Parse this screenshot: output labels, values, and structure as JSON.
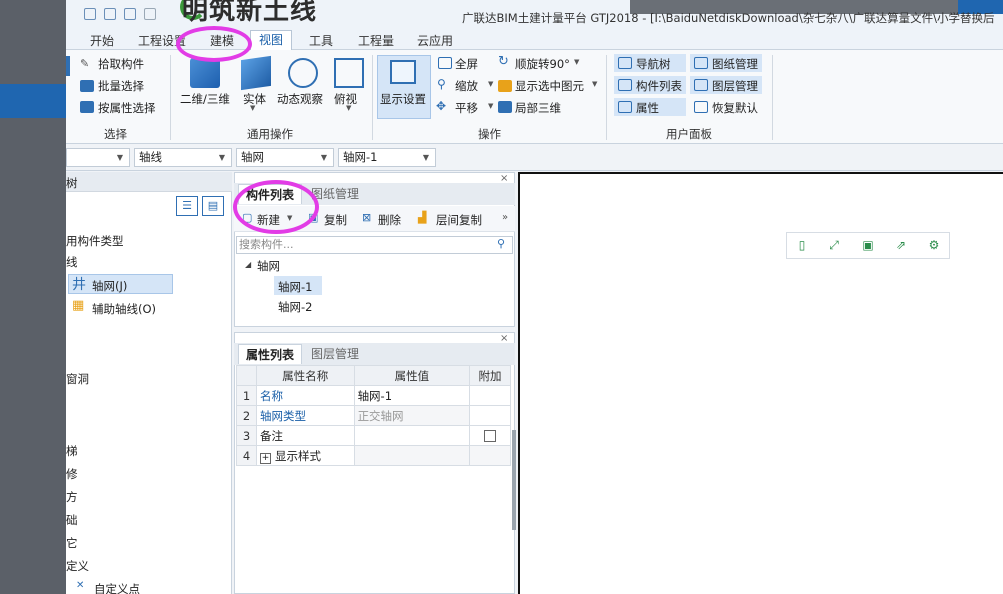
{
  "window": {
    "title": "广联达BIM土建计量平台 GTJ2018 - [I:\\BaiduNetdiskDownload\\杂七杂八\\广联达算量文件\\小学替换后",
    "watermark": "明筑新土线"
  },
  "menu": {
    "tabs": [
      {
        "label": "开始",
        "active": false
      },
      {
        "label": "工程设置",
        "active": false
      },
      {
        "label": "建模",
        "active": false
      },
      {
        "label": "视图",
        "active": true
      },
      {
        "label": "工具",
        "active": false
      },
      {
        "label": "工程量",
        "active": false
      },
      {
        "label": "云应用",
        "active": false
      }
    ]
  },
  "ribbon": {
    "select_group": {
      "label": "选择",
      "items": [
        "拾取构件",
        "批量选择",
        "按属性选择"
      ]
    },
    "general_group": {
      "label": "通用操作",
      "items": [
        "二维/三维",
        "实体",
        "动态观察",
        "俯视"
      ]
    },
    "operate_group": {
      "label": "操作",
      "display_settings": "显示设置",
      "items": [
        "全屏",
        "缩放",
        "平移",
        "顺旋转90°",
        "显示选中图元",
        "局部三维"
      ]
    },
    "user_panel_group": {
      "label": "用户面板",
      "items": [
        "导航树",
        "图纸管理",
        "构件列表",
        "图层管理",
        "属性",
        "恢复默认"
      ]
    }
  },
  "selectors": {
    "floor": "",
    "category": "轴线",
    "type": "轴网",
    "instance": "轴网-1"
  },
  "navigator": {
    "title_partial": "树",
    "items": [
      {
        "label": "用构件类型",
        "selected": false
      },
      {
        "label": "线",
        "selected": false
      },
      {
        "label": "轴网(J)",
        "selected": true
      },
      {
        "label": "辅助轴线(O)",
        "selected": false
      },
      {
        "label": "窗洞",
        "selected": false
      },
      {
        "label": "梯",
        "selected": false
      },
      {
        "label": "修",
        "selected": false
      },
      {
        "label": "方",
        "selected": false
      },
      {
        "label": "础",
        "selected": false
      },
      {
        "label": "它",
        "selected": false
      },
      {
        "label": "定义",
        "selected": false
      },
      {
        "label": "自定义点",
        "selected": false
      }
    ]
  },
  "component_panel": {
    "tabs": [
      {
        "label": "构件列表",
        "active": true
      },
      {
        "label": "图纸管理",
        "active": false
      }
    ],
    "toolbar": {
      "new": "新建",
      "copy": "复制",
      "delete": "删除",
      "floor_copy": "层间复制",
      "more": "»"
    },
    "search_placeholder": "搜索构件...",
    "tree": {
      "root": "轴网",
      "children": [
        {
          "label": "轴网-1",
          "selected": true
        },
        {
          "label": "轴网-2",
          "selected": false
        }
      ]
    }
  },
  "property_panel": {
    "tabs": [
      {
        "label": "属性列表",
        "active": true
      },
      {
        "label": "图层管理",
        "active": false
      }
    ],
    "headers": [
      "属性名称",
      "属性值",
      "附加"
    ],
    "rows": [
      {
        "index": "1",
        "name": "名称",
        "value": "轴网-1",
        "name_style": "blue",
        "value_style": "normal",
        "has_checkbox": false
      },
      {
        "index": "2",
        "name": "轴网类型",
        "value": "正交轴网",
        "name_style": "blue",
        "value_style": "gray",
        "has_checkbox": false
      },
      {
        "index": "3",
        "name": "备注",
        "value": "",
        "name_style": "normal",
        "value_style": "normal",
        "has_checkbox": true
      },
      {
        "index": "4",
        "name": "显示样式",
        "value": "",
        "name_style": "normal",
        "value_style": "normal",
        "has_checkbox": false,
        "expandable": "+"
      }
    ]
  },
  "canvas_toolbar": {
    "icons": [
      "phone-icon",
      "fullscreen-icon",
      "save-icon",
      "export-icon",
      "settings-icon"
    ]
  },
  "colors": {
    "accent": "#1a5fa8",
    "annotation": "#e23ce6",
    "selection": "#d5e5f7"
  }
}
